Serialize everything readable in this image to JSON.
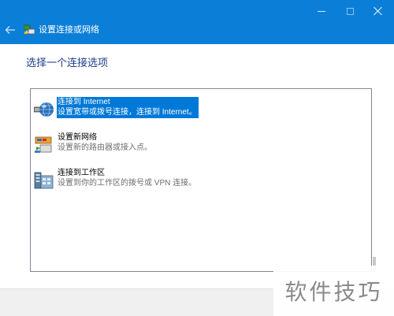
{
  "window": {
    "title": "设置连接或网络",
    "controls": {
      "minimize": "minimize-icon",
      "maximize": "maximize-icon",
      "close": "close-icon"
    },
    "back_icon": "arrow-left-icon",
    "app_icon": "network-setup-icon"
  },
  "colors": {
    "titlebar": "#0b7fd8",
    "heading": "#1f3c88",
    "selection": "#0078d7",
    "footer": "#f0f0f0"
  },
  "main": {
    "heading": "选择一个连接选项",
    "options": [
      {
        "title": "连接到 Internet",
        "description": "设置宽带或拨号连接，连接到 Internet。",
        "icon": "globe-connect-icon",
        "selected": true
      },
      {
        "title": "设置新网络",
        "description": "设置新的路由器或接入点。",
        "icon": "router-setup-icon",
        "selected": false
      },
      {
        "title": "连接到工作区",
        "description": "设置到你的工作区的拨号或 VPN 连接。",
        "icon": "workplace-vpn-icon",
        "selected": false
      }
    ]
  },
  "watermark": {
    "text": "软件技巧"
  }
}
